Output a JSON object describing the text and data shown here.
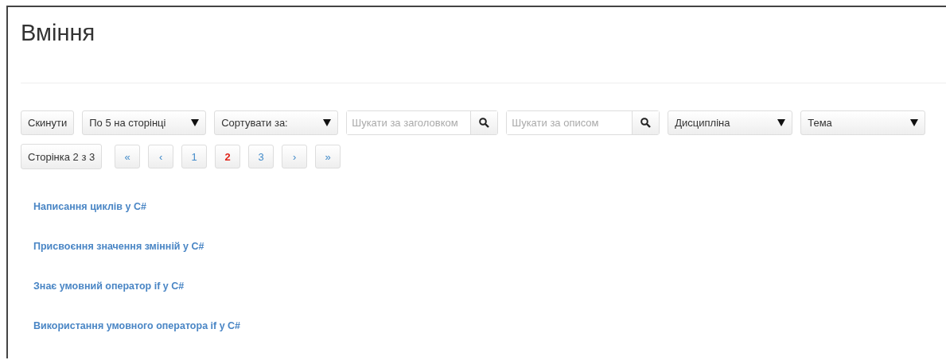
{
  "title": "Вміння",
  "toolbar": {
    "reset_button": "Скинути",
    "per_page": {
      "value": "По 5 на сторінці"
    },
    "sort": {
      "value": "Сортувати за:"
    },
    "title_search": {
      "placeholder": "Шукати за заголовком"
    },
    "description_search": {
      "placeholder": "Шукати за описом"
    },
    "discipline": {
      "value": "Дисципліна"
    },
    "topic": {
      "value": "Тема"
    }
  },
  "pagination": {
    "page_info": "Сторінка 2 з 3",
    "items": [
      {
        "label": "«",
        "selected": false
      },
      {
        "label": "‹",
        "selected": false
      },
      {
        "label": "1",
        "selected": false
      },
      {
        "label": "2",
        "selected": true
      },
      {
        "label": "3",
        "selected": false
      },
      {
        "label": "›",
        "selected": false
      },
      {
        "label": "»",
        "selected": false
      }
    ]
  },
  "skills": [
    "Написання циклів у C#",
    "Присвоєння значення змінній у C#",
    "Знає умовний оператор if у C#",
    "Використання умовного оператора if у C#"
  ]
}
